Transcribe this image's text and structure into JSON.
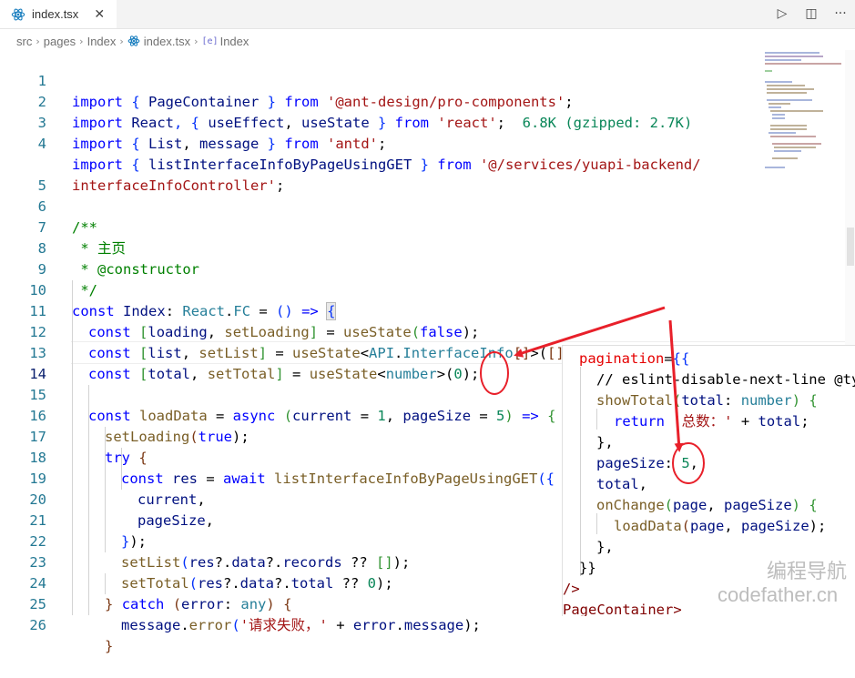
{
  "tab": {
    "filename": "index.tsx",
    "close_glyph": "✕",
    "icon": "react-icon"
  },
  "toolbar": {
    "run_glyph": "▷",
    "split_glyph": "◫",
    "more_glyph": "···"
  },
  "breadcrumb": {
    "items": [
      "src",
      "pages",
      "Index",
      "index.tsx",
      "Index"
    ],
    "symbol_glyph": "[e]"
  },
  "lines": [
    {
      "no": "1"
    },
    {
      "no": "2"
    },
    {
      "no": "3"
    },
    {
      "no": "4"
    },
    {
      "no": ""
    },
    {
      "no": "5"
    },
    {
      "no": "6"
    },
    {
      "no": "7"
    },
    {
      "no": "8"
    },
    {
      "no": "9"
    },
    {
      "no": "10"
    },
    {
      "no": "11"
    },
    {
      "no": "12"
    },
    {
      "no": "13"
    },
    {
      "no": "14"
    },
    {
      "no": "15"
    },
    {
      "no": "16"
    },
    {
      "no": "17"
    },
    {
      "no": "18"
    },
    {
      "no": "19"
    },
    {
      "no": "20"
    },
    {
      "no": "21"
    },
    {
      "no": "22"
    },
    {
      "no": "23"
    },
    {
      "no": "24"
    },
    {
      "no": "25"
    },
    {
      "no": "26"
    }
  ],
  "code": {
    "l1": [
      "import",
      " { ",
      "PageContainer",
      " } ",
      "from",
      " ",
      "'@ant-design/pro-components'",
      ";"
    ],
    "l2": [
      "import",
      " ",
      "React",
      ", { ",
      "useEffect",
      ", ",
      "useState",
      " } ",
      "from",
      " ",
      "'react'",
      ";",
      "  6.8K (gzipped: 2.7K)"
    ],
    "l3": [
      "import",
      " { ",
      "List",
      ", ",
      "message",
      " } ",
      "from",
      " ",
      "'antd'",
      ";"
    ],
    "l4": [
      "import",
      " { ",
      "listInterfaceInfoByPageUsingGET",
      " } ",
      "from",
      " ",
      "'@/services/yuapi-backend/"
    ],
    "l4b": [
      "interfaceInfoController'",
      ";"
    ],
    "l6": "/**",
    "l7": " * 主页",
    "l8": " * @constructor",
    "l9": " */",
    "l10": [
      "const",
      " ",
      "Index",
      ": ",
      "React",
      ".",
      "FC",
      " = ",
      "()",
      " ",
      "=>",
      " ",
      "{"
    ],
    "l11": [
      "const",
      " ",
      "[",
      "loading",
      ", ",
      "setLoading",
      "]",
      " = ",
      "useState",
      "(",
      "false",
      ");"
    ],
    "l12": [
      "const",
      " ",
      "[",
      "list",
      ", ",
      "setList",
      "]",
      " = ",
      "useState",
      "<",
      "API",
      ".",
      "InterfaceInfo",
      "[]",
      ">(",
      "[]",
      ");"
    ],
    "l13": [
      "const",
      " ",
      "[",
      "total",
      ", ",
      "setTotal",
      "]",
      " = ",
      "useState",
      "<",
      "number",
      ">(",
      "0",
      ");"
    ],
    "l15": [
      "const",
      " ",
      "loadData",
      " = ",
      "async",
      " ",
      "(",
      "current",
      " = ",
      "1",
      ", ",
      "pageSize",
      " = ",
      "5",
      ")",
      " ",
      "=>",
      " ",
      "{"
    ],
    "l16": [
      "setLoading",
      "(",
      "true",
      ");"
    ],
    "l17": [
      "try",
      " ",
      "{"
    ],
    "l18": [
      "const",
      " ",
      "res",
      " = ",
      "await",
      " ",
      "listInterfaceInfoByPageUsingGET",
      "({"
    ],
    "l19": [
      "current",
      ","
    ],
    "l20": [
      "pageSize",
      ","
    ],
    "l21": [
      "}",
      ");"
    ],
    "l22": [
      "setList",
      "(",
      "res",
      "?.",
      "data",
      "?.",
      "records",
      " ?? ",
      "[]",
      ");"
    ],
    "l23": [
      "setTotal",
      "(",
      "res",
      "?.",
      "data",
      "?.",
      "total",
      " ?? ",
      "0",
      ");"
    ],
    "l24": [
      "}",
      " ",
      "catch",
      " ",
      "(",
      "error",
      ": ",
      "any",
      ")",
      " ",
      "{"
    ],
    "l25": [
      "message",
      ".",
      "error",
      "(",
      "'请求失败，'",
      " + ",
      "error",
      ".",
      "message",
      ");"
    ],
    "l26": "}"
  },
  "panel": {
    "p1": [
      "pagination",
      "=",
      "{{"
    ],
    "p2": "// eslint-disable-next-line @ty",
    "p3": [
      "showTotal",
      "(",
      "total",
      ": ",
      "number",
      ")",
      " ",
      "{"
    ],
    "p4": [
      "return",
      " ",
      "'总数：'",
      " + ",
      "total",
      ";"
    ],
    "p5": "},",
    "p6": [
      "pageSize",
      ": ",
      "5",
      ","
    ],
    "p7": [
      "total",
      ","
    ],
    "p8": [
      "onChange",
      "(",
      "page",
      ", ",
      "pageSize",
      ")",
      " ",
      "{"
    ],
    "p9": [
      "loadData",
      "(",
      "page",
      ", ",
      "pageSize",
      ");"
    ],
    "p10": "},",
    "p11": "}}",
    "p12": "/>",
    "p13": "PageContainer>"
  },
  "watermark": {
    "line1": "编程导航",
    "line2": "codefather.cn"
  },
  "colors": {
    "keyword": "#0000ff",
    "string": "#a31515",
    "comment": "#008000",
    "function": "#795e26",
    "variable": "#001080",
    "type": "#267f99",
    "number": "#098658",
    "annotation": "#e8202a"
  }
}
